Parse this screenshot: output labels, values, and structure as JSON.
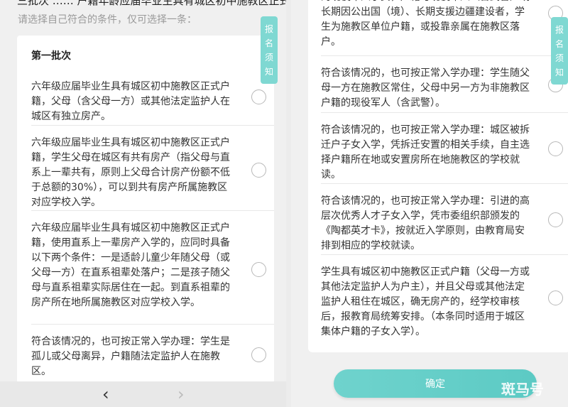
{
  "left": {
    "top_cut_text": "三批次 …… 户籍年龄应届毕业生具有城区初中施教区正式户籍",
    "prompt": "请选择自己符合的条件，仅可选择一条：",
    "batch_title": "第一批次",
    "options": [
      {
        "text": "六年级应届毕业生具有城区初中施教区正式户籍，父母（含父母一方）或其他法定监护人在城区有独立房产。"
      },
      {
        "text": "六年级应届毕业生具有城区初中施教区正式户籍，学生父母在城区有共有房产（指父母与直系上一辈共有，原则上父母合计房产份额不低于总额的30%），可以到共有房产所属施教区对应学校入学。"
      },
      {
        "text": "六年级应届毕业生具有城区初中施教区正式户籍，使用直系上一辈房产入学的，应同时具备以下两个条件：一是适龄儿童少年随父母（或父母一方）在直系祖辈处落户；二是孩子随父母与直系祖辈实际居住在一起。到直系祖辈的房产所在地所属施教区对应学校入学。"
      },
      {
        "text": "符合该情况的，也可按正常入学办理：学生是孤儿或父母离异，户籍随法定监护人在施教区。"
      }
    ],
    "notice_tab": [
      "报",
      "名",
      "须",
      "知"
    ],
    "prev_arrow": "‹",
    "next_arrow": "›"
  },
  "right": {
    "options": [
      {
        "text": "的现役军人子女，户籍与现役军人（含武警）或长期因公出国（境）、长期支援边疆建设者，学生为施教区单位户籍，或投靠亲属在施教区落户。"
      },
      {
        "text": "符合该情况的，也可按正常入学办理：学生随父母一方在施教区常住，父母中另一方为非施教区户籍的现役军人（含武警）。"
      },
      {
        "text": "符合该情况的，也可按正常入学办理：城区被拆迁户子女入学，凭拆迁安置的相关手续，自主选择户籍所在地或安置房所在地施教区的学校就读。"
      },
      {
        "text": "符合该情况的，也可按正常入学办理：引进的高层次优秀人才子女入学，凭市委组织部颁发的《陶都英才卡》，按就近入学原则，由教育局安排到相应的学校就读。"
      },
      {
        "text": "学生具有城区初中施教区正式户籍（父母一方或其他法定监护人为户主），并且父母或其他法定监护人租住在城区，确无房产的，经学校审核后，报教育局统筹安排。（本条同时适用于城区集体户籍的子女入学）。"
      }
    ],
    "notice_tab": [
      "报",
      "名",
      "须",
      "知"
    ],
    "confirm_label": "确定",
    "watermark": "斑马号"
  }
}
